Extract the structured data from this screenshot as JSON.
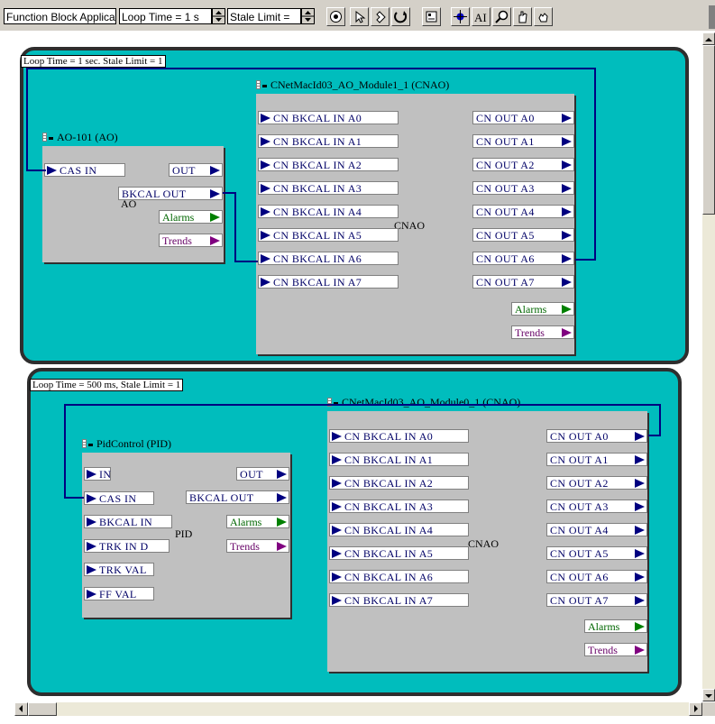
{
  "toolbar": {
    "function_field": "Function Block Applicati",
    "loop_time_field": "Loop Time = 1 s",
    "stale_limit_field": "Stale Limit =",
    "buttons": [
      "view-options-icon",
      "pointer-icon",
      "connect-icon",
      "rotate-icon",
      "block-icon",
      "io-block-icon",
      "text-ai-icon",
      "zoom-icon",
      "pan-hand-icon",
      "grab-icon"
    ]
  },
  "loops": [
    {
      "label": "Loop Time = 1 sec. Stale Limit = 1",
      "blocks": [
        {
          "title": "AO-101 (AO)",
          "type": "AO",
          "inputs": [
            "CAS IN"
          ],
          "outputs": [
            "OUT",
            "BKCAL OUT"
          ],
          "alarms": "Alarms",
          "trends": "Trends"
        },
        {
          "title": "CNetMacId03_AO_Module1_1 (CNAO)",
          "type": "CNAO",
          "inputs": [
            "CN BKCAL IN A0",
            "CN BKCAL IN A1",
            "CN BKCAL IN A2",
            "CN BKCAL IN A3",
            "CN BKCAL IN A4",
            "CN BKCAL IN A5",
            "CN BKCAL IN A6",
            "CN BKCAL IN A7"
          ],
          "outputs": [
            "CN OUT A0",
            "CN OUT A1",
            "CN OUT A2",
            "CN OUT A3",
            "CN OUT A4",
            "CN OUT A5",
            "CN OUT A6",
            "CN OUT A7"
          ],
          "alarms": "Alarms",
          "trends": "Trends"
        }
      ]
    },
    {
      "label": "Loop Time = 500 ms, Stale Limit = 1",
      "blocks": [
        {
          "title": "PidControl (PID)",
          "type": "PID",
          "inputs": [
            "IN",
            "CAS IN",
            "BKCAL IN",
            "TRK IN D",
            "TRK VAL",
            "FF VAL"
          ],
          "outputs": [
            "OUT",
            "BKCAL OUT"
          ],
          "alarms": "Alarms",
          "trends": "Trends"
        },
        {
          "title": "CNetMacId03_AO_Module0_1 (CNAO)",
          "type": "CNAO",
          "inputs": [
            "CN BKCAL IN A0",
            "CN BKCAL IN A1",
            "CN BKCAL IN A2",
            "CN BKCAL IN A3",
            "CN BKCAL IN A4",
            "CN BKCAL IN A5",
            "CN BKCAL IN A6",
            "CN BKCAL IN A7"
          ],
          "outputs": [
            "CN OUT A0",
            "CN OUT A1",
            "CN OUT A2",
            "CN OUT A3",
            "CN OUT A4",
            "CN OUT A5",
            "CN OUT A6",
            "CN OUT A7"
          ],
          "alarms": "Alarms",
          "trends": "Trends"
        }
      ]
    }
  ],
  "colors": {
    "loop_bg": "#00bdbd",
    "block_bg": "#c0c0c0",
    "wire": "#000080",
    "port_text": "#000066",
    "alarms_text": "#006600",
    "trends_text": "#660066"
  }
}
